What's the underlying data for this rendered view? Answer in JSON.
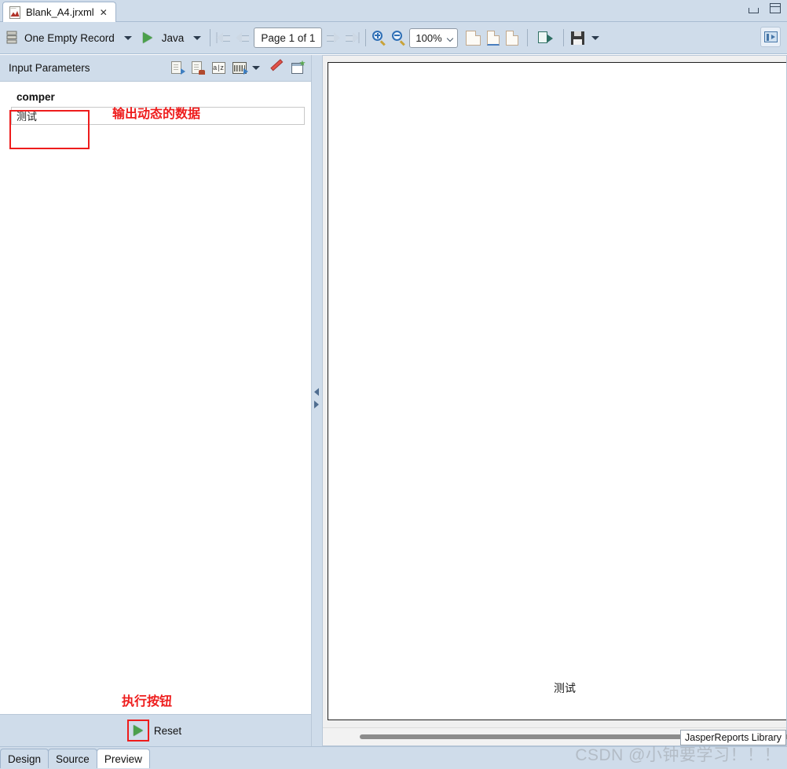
{
  "window": {
    "tab_title": "Blank_A4.jrxml",
    "tab_close": "✕",
    "minimize_icon": "minimize-icon",
    "maximize_icon": "maximize-icon"
  },
  "toolbar": {
    "datasource_label": "One Empty Record",
    "language_label": "Java",
    "page_field_value": "Page 1 of 1",
    "zoom_value": "100%",
    "run_icon": "run-report-icon",
    "datasource_icon": "database-icon",
    "first_page_icon": "first-page-icon",
    "prev_page_icon": "previous-page-icon",
    "next_page_icon": "next-page-icon",
    "last_page_icon": "last-page-icon",
    "zoom_in_icon": "zoom-in-icon",
    "zoom_out_icon": "zoom-out-icon",
    "actual_size_icon": "actual-size-icon",
    "fit_width_icon": "fit-width-icon",
    "fit_page_icon": "fit-page-icon",
    "export_icon": "export-icon",
    "save_icon": "save-icon",
    "save_dropdown_icon": "chevron-down-icon",
    "open_external_icon": "open-in-external-viewer-icon"
  },
  "left_panel": {
    "title": "Input Parameters",
    "icons": [
      {
        "name": "load-parameters-icon"
      },
      {
        "name": "save-parameters-icon"
      },
      {
        "name": "sort-alphabetically-icon",
        "glyph": "az"
      },
      {
        "name": "prompt-all-parameters-icon"
      },
      {
        "name": "chevron-down-icon"
      },
      {
        "name": "clear-parameters-icon"
      },
      {
        "name": "open-parameters-window-icon"
      }
    ],
    "parameter": {
      "name": "comper",
      "value": "测试"
    },
    "footer": {
      "reset_label": "Reset",
      "reset_icon": "run-green-triangle-icon"
    }
  },
  "annotations": [
    {
      "id": "output-dynamic-data",
      "text": "输出动态的数据"
    },
    {
      "id": "execute-button",
      "text": "执行按钮"
    }
  ],
  "preview": {
    "report_text": "测试",
    "tooltip": "JasperReports Library",
    "scrollbar_icon": "horizontal-scrollbar"
  },
  "splitter": {
    "collapse_left_icon": "collapse-left-arrow-icon",
    "expand_right_icon": "expand-right-arrow-icon"
  },
  "bottom_tabs": [
    {
      "label": "Design",
      "active": false
    },
    {
      "label": "Source",
      "active": false
    },
    {
      "label": "Preview",
      "active": true
    }
  ],
  "watermark": "CSDN @小钟要学习！！！",
  "colors": {
    "chrome": "#cfdcea",
    "annotation_red": "#ee1c1c",
    "run_green": "#4ba04b"
  }
}
